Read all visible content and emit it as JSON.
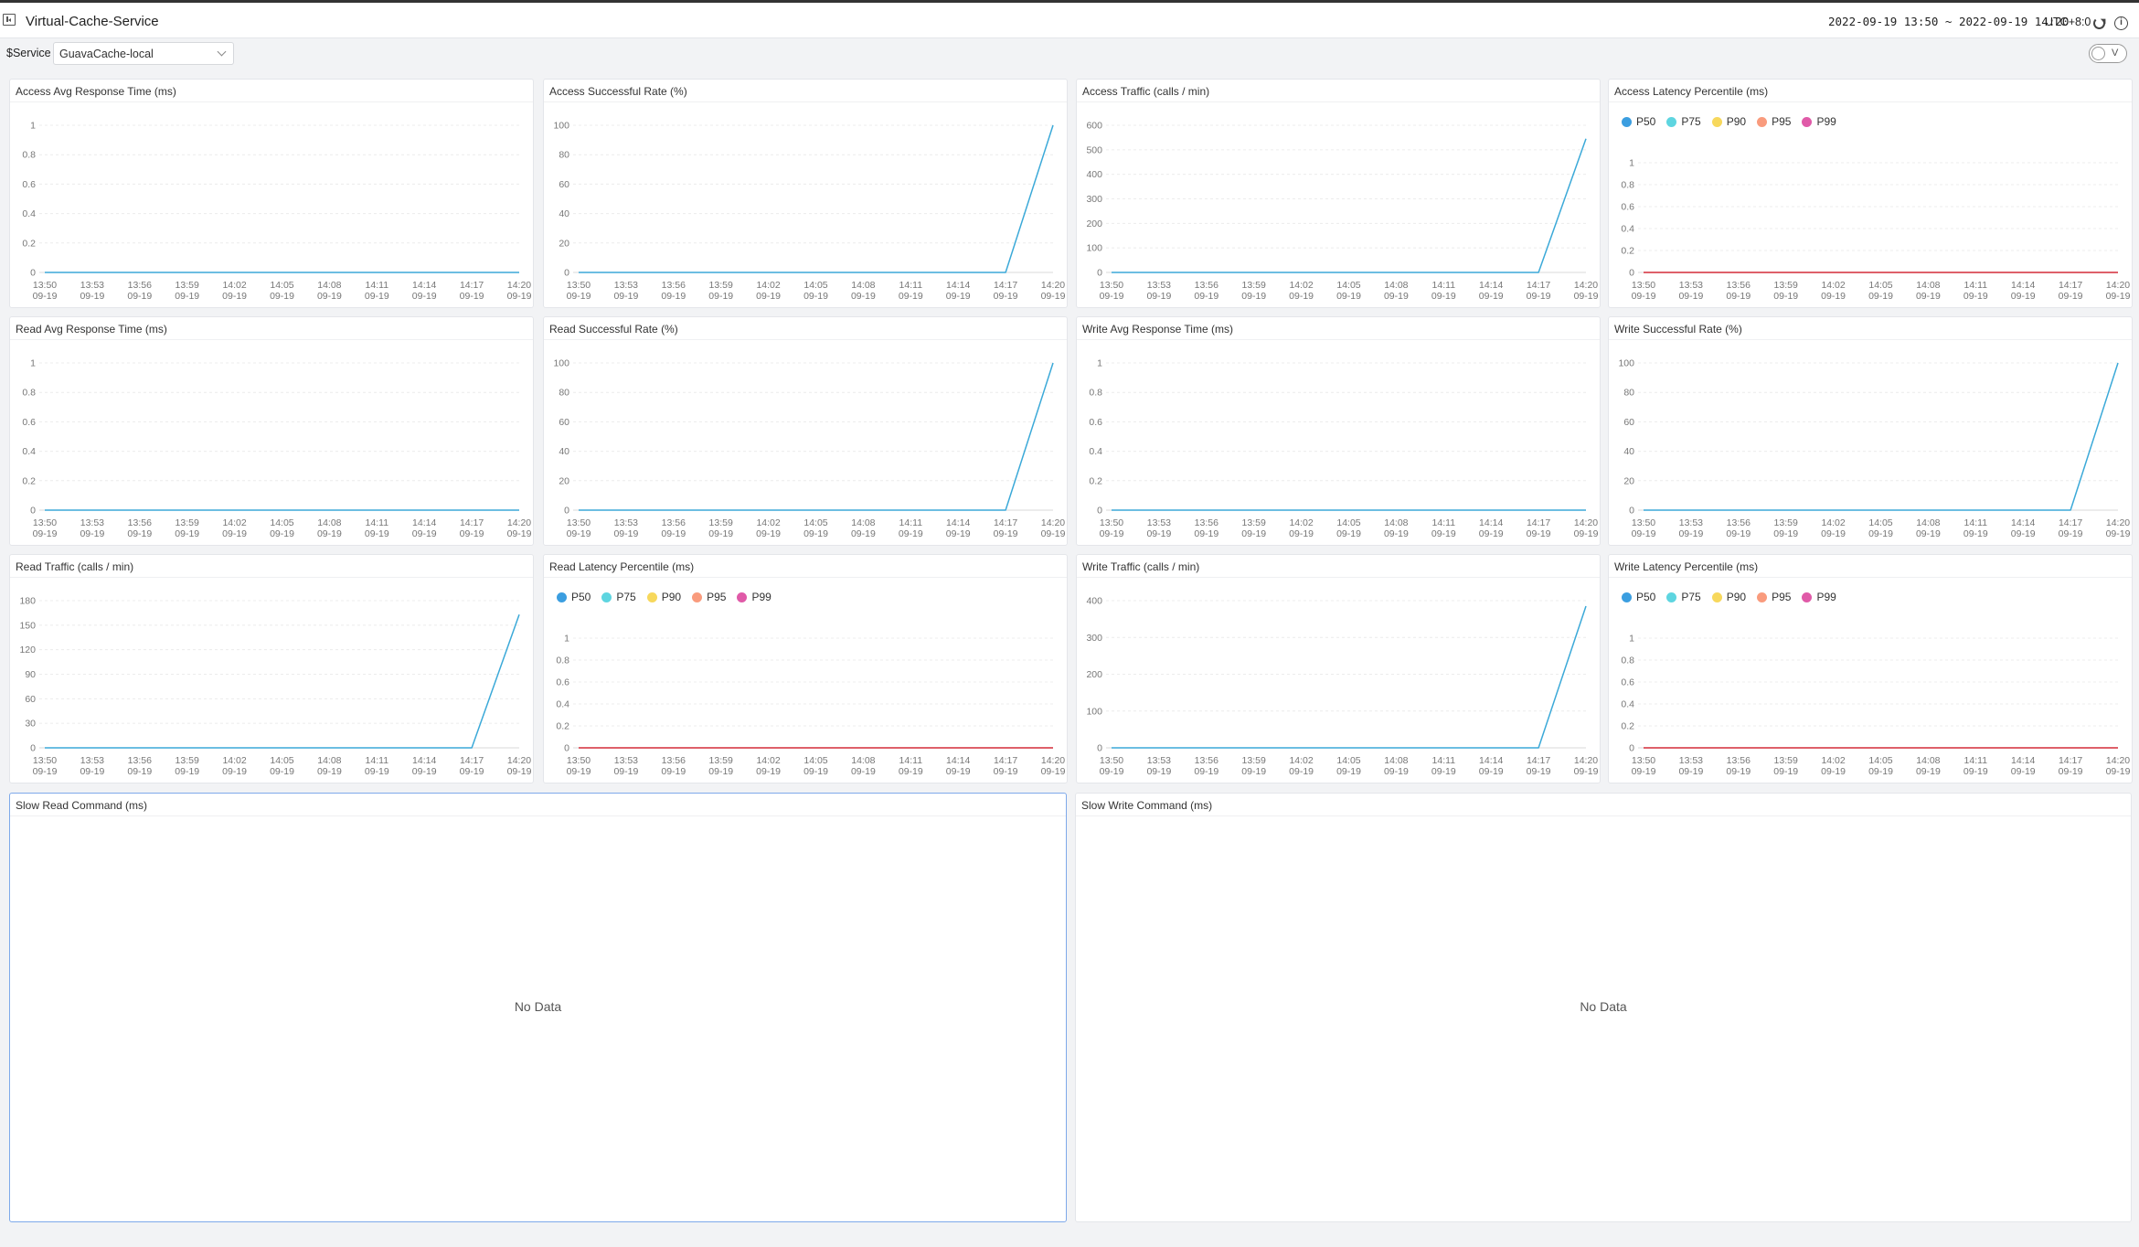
{
  "header": {
    "title": "Virtual-Cache-Service",
    "time_range": "2022-09-19 13:50 ~ 2022-09-19 14:20",
    "timezone": "UTC+8:0"
  },
  "variables": {
    "label": "$Service",
    "value": "GuavaCache-local"
  },
  "toggle": {
    "label": "V"
  },
  "colors": {
    "line": "#3ba9d8",
    "flat_latency": "#e0425f",
    "grid": "#ececec",
    "tick": "#777777",
    "panel_border": "#e4e6ea",
    "active_border": "#7ea9ea"
  },
  "icons": {
    "menu": "sidebar-toggle-icon",
    "reload": "reload-icon",
    "info": "info-icon",
    "select": "chevron-down-icon"
  },
  "panels": [
    {
      "title": "Access Avg Response Time (ms)"
    },
    {
      "title": "Access Successful Rate (%)"
    },
    {
      "title": "Access Traffic (calls / min)"
    },
    {
      "title": "Access Latency Percentile (ms)"
    },
    {
      "title": "Read Avg Response Time (ms)"
    },
    {
      "title": "Read Successful Rate (%)"
    },
    {
      "title": "Write Avg Response Time (ms)"
    },
    {
      "title": "Write Successful Rate (%)"
    },
    {
      "title": "Read Traffic (calls / min)"
    },
    {
      "title": "Read Latency Percentile (ms)"
    },
    {
      "title": "Write Traffic (calls / min)"
    },
    {
      "title": "Write Latency Percentile (ms)"
    },
    {
      "title": "Slow Read Command (ms)",
      "empty_text": "No Data"
    },
    {
      "title": "Slow Write Command (ms)",
      "empty_text": "No Data"
    }
  ],
  "chart_data": [
    {
      "type": "line",
      "title": "Access Avg Response Time (ms)",
      "x": [
        "13:50\n09-19",
        "13:53\n09-19",
        "13:56\n09-19",
        "13:59\n09-19",
        "14:02\n09-19",
        "14:05\n09-19",
        "14:08\n09-19",
        "14:11\n09-19",
        "14:14\n09-19",
        "14:17\n09-19",
        "14:20\n09-19"
      ],
      "ylim": [
        0,
        1
      ],
      "yticks": [
        "0",
        "0.2",
        "0.4",
        "0.6",
        "0.8",
        "1"
      ],
      "series": [
        {
          "values": [
            0,
            0,
            0,
            0,
            0,
            0,
            0,
            0,
            0,
            0,
            0
          ],
          "color": "#3ba9d8"
        }
      ]
    },
    {
      "type": "line",
      "title": "Access Successful Rate (%)",
      "x": [
        "13:50\n09-19",
        "13:53\n09-19",
        "13:56\n09-19",
        "13:59\n09-19",
        "14:02\n09-19",
        "14:05\n09-19",
        "14:08\n09-19",
        "14:11\n09-19",
        "14:14\n09-19",
        "14:17\n09-19",
        "14:20\n09-19"
      ],
      "ylim": [
        0,
        100
      ],
      "yticks": [
        "0",
        "20",
        "40",
        "60",
        "80",
        "100"
      ],
      "series": [
        {
          "values": [
            0,
            0,
            0,
            0,
            0,
            0,
            0,
            0,
            0,
            0,
            100
          ],
          "color": "#3ba9d8"
        }
      ]
    },
    {
      "type": "line",
      "title": "Access Traffic (calls / min)",
      "x": [
        "13:50\n09-19",
        "13:53\n09-19",
        "13:56\n09-19",
        "13:59\n09-19",
        "14:02\n09-19",
        "14:05\n09-19",
        "14:08\n09-19",
        "14:11\n09-19",
        "14:14\n09-19",
        "14:17\n09-19",
        "14:20\n09-19"
      ],
      "ylim": [
        0,
        600
      ],
      "yticks": [
        "0",
        "100",
        "200",
        "300",
        "400",
        "500",
        "600"
      ],
      "series": [
        {
          "values": [
            0,
            0,
            0,
            0,
            0,
            0,
            0,
            0,
            0,
            0,
            545
          ],
          "color": "#3ba9d8"
        }
      ]
    },
    {
      "type": "line",
      "title": "Access Latency Percentile (ms)",
      "x": [
        "13:50\n09-19",
        "13:53\n09-19",
        "13:56\n09-19",
        "13:59\n09-19",
        "14:02\n09-19",
        "14:05\n09-19",
        "14:08\n09-19",
        "14:11\n09-19",
        "14:14\n09-19",
        "14:17\n09-19",
        "14:20\n09-19"
      ],
      "ylim": [
        0,
        1
      ],
      "yticks": [
        "0",
        "0.2",
        "0.4",
        "0.6",
        "0.8",
        "1"
      ],
      "legend": [
        {
          "name": "P50",
          "color": "#3b9ee0"
        },
        {
          "name": "P75",
          "color": "#5ed5e0"
        },
        {
          "name": "P90",
          "color": "#f7d85c"
        },
        {
          "name": "P95",
          "color": "#f99b7d"
        },
        {
          "name": "P99",
          "color": "#e05aa8"
        }
      ],
      "series": [
        {
          "name": "P50",
          "values": [
            0,
            0,
            0,
            0,
            0,
            0,
            0,
            0,
            0,
            0,
            0
          ],
          "color": "#3b9ee0"
        },
        {
          "name": "P75",
          "values": [
            0,
            0,
            0,
            0,
            0,
            0,
            0,
            0,
            0,
            0,
            0
          ],
          "color": "#5ed5e0"
        },
        {
          "name": "P90",
          "values": [
            0,
            0,
            0,
            0,
            0,
            0,
            0,
            0,
            0,
            0,
            0
          ],
          "color": "#f7d85c"
        },
        {
          "name": "P95",
          "values": [
            0,
            0,
            0,
            0,
            0,
            0,
            0,
            0,
            0,
            0,
            0
          ],
          "color": "#f99b7d"
        },
        {
          "name": "P99",
          "values": [
            0,
            0,
            0,
            0,
            0,
            0,
            0,
            0,
            0,
            0,
            0
          ],
          "color": "#e0425f"
        }
      ]
    },
    {
      "type": "line",
      "title": "Read Avg Response Time (ms)",
      "x": [
        "13:50\n09-19",
        "13:53\n09-19",
        "13:56\n09-19",
        "13:59\n09-19",
        "14:02\n09-19",
        "14:05\n09-19",
        "14:08\n09-19",
        "14:11\n09-19",
        "14:14\n09-19",
        "14:17\n09-19",
        "14:20\n09-19"
      ],
      "ylim": [
        0,
        1
      ],
      "yticks": [
        "0",
        "0.2",
        "0.4",
        "0.6",
        "0.8",
        "1"
      ],
      "series": [
        {
          "values": [
            0,
            0,
            0,
            0,
            0,
            0,
            0,
            0,
            0,
            0,
            0
          ],
          "color": "#3ba9d8"
        }
      ]
    },
    {
      "type": "line",
      "title": "Read Successful Rate (%)",
      "x": [
        "13:50\n09-19",
        "13:53\n09-19",
        "13:56\n09-19",
        "13:59\n09-19",
        "14:02\n09-19",
        "14:05\n09-19",
        "14:08\n09-19",
        "14:11\n09-19",
        "14:14\n09-19",
        "14:17\n09-19",
        "14:20\n09-19"
      ],
      "ylim": [
        0,
        100
      ],
      "yticks": [
        "0",
        "20",
        "40",
        "60",
        "80",
        "100"
      ],
      "series": [
        {
          "values": [
            0,
            0,
            0,
            0,
            0,
            0,
            0,
            0,
            0,
            0,
            100
          ],
          "color": "#3ba9d8"
        }
      ]
    },
    {
      "type": "line",
      "title": "Write Avg Response Time (ms)",
      "x": [
        "13:50\n09-19",
        "13:53\n09-19",
        "13:56\n09-19",
        "13:59\n09-19",
        "14:02\n09-19",
        "14:05\n09-19",
        "14:08\n09-19",
        "14:11\n09-19",
        "14:14\n09-19",
        "14:17\n09-19",
        "14:20\n09-19"
      ],
      "ylim": [
        0,
        1
      ],
      "yticks": [
        "0",
        "0.2",
        "0.4",
        "0.6",
        "0.8",
        "1"
      ],
      "series": [
        {
          "values": [
            0,
            0,
            0,
            0,
            0,
            0,
            0,
            0,
            0,
            0,
            0
          ],
          "color": "#3ba9d8"
        }
      ]
    },
    {
      "type": "line",
      "title": "Write Successful Rate (%)",
      "x": [
        "13:50\n09-19",
        "13:53\n09-19",
        "13:56\n09-19",
        "13:59\n09-19",
        "14:02\n09-19",
        "14:05\n09-19",
        "14:08\n09-19",
        "14:11\n09-19",
        "14:14\n09-19",
        "14:17\n09-19",
        "14:20\n09-19"
      ],
      "ylim": [
        0,
        100
      ],
      "yticks": [
        "0",
        "20",
        "40",
        "60",
        "80",
        "100"
      ],
      "series": [
        {
          "values": [
            0,
            0,
            0,
            0,
            0,
            0,
            0,
            0,
            0,
            0,
            100
          ],
          "color": "#3ba9d8"
        }
      ]
    },
    {
      "type": "line",
      "title": "Read Traffic (calls / min)",
      "x": [
        "13:50\n09-19",
        "13:53\n09-19",
        "13:56\n09-19",
        "13:59\n09-19",
        "14:02\n09-19",
        "14:05\n09-19",
        "14:08\n09-19",
        "14:11\n09-19",
        "14:14\n09-19",
        "14:17\n09-19",
        "14:20\n09-19"
      ],
      "ylim": [
        0,
        180
      ],
      "yticks": [
        "0",
        "30",
        "60",
        "90",
        "120",
        "150",
        "180"
      ],
      "series": [
        {
          "values": [
            0,
            0,
            0,
            0,
            0,
            0,
            0,
            0,
            0,
            0,
            163
          ],
          "color": "#3ba9d8"
        }
      ]
    },
    {
      "type": "line",
      "title": "Read Latency Percentile (ms)",
      "x": [
        "13:50\n09-19",
        "13:53\n09-19",
        "13:56\n09-19",
        "13:59\n09-19",
        "14:02\n09-19",
        "14:05\n09-19",
        "14:08\n09-19",
        "14:11\n09-19",
        "14:14\n09-19",
        "14:17\n09-19",
        "14:20\n09-19"
      ],
      "ylim": [
        0,
        1
      ],
      "yticks": [
        "0",
        "0.2",
        "0.4",
        "0.6",
        "0.8",
        "1"
      ],
      "legend": [
        {
          "name": "P50",
          "color": "#3b9ee0"
        },
        {
          "name": "P75",
          "color": "#5ed5e0"
        },
        {
          "name": "P90",
          "color": "#f7d85c"
        },
        {
          "name": "P95",
          "color": "#f99b7d"
        },
        {
          "name": "P99",
          "color": "#e05aa8"
        }
      ],
      "series": [
        {
          "name": "P50",
          "values": [
            0,
            0,
            0,
            0,
            0,
            0,
            0,
            0,
            0,
            0,
            0
          ],
          "color": "#3b9ee0"
        },
        {
          "name": "P75",
          "values": [
            0,
            0,
            0,
            0,
            0,
            0,
            0,
            0,
            0,
            0,
            0
          ],
          "color": "#5ed5e0"
        },
        {
          "name": "P90",
          "values": [
            0,
            0,
            0,
            0,
            0,
            0,
            0,
            0,
            0,
            0,
            0
          ],
          "color": "#f7d85c"
        },
        {
          "name": "P95",
          "values": [
            0,
            0,
            0,
            0,
            0,
            0,
            0,
            0,
            0,
            0,
            0
          ],
          "color": "#f99b7d"
        },
        {
          "name": "P99",
          "values": [
            0,
            0,
            0,
            0,
            0,
            0,
            0,
            0,
            0,
            0,
            0
          ],
          "color": "#e0425f"
        }
      ]
    },
    {
      "type": "line",
      "title": "Write Traffic (calls / min)",
      "x": [
        "13:50\n09-19",
        "13:53\n09-19",
        "13:56\n09-19",
        "13:59\n09-19",
        "14:02\n09-19",
        "14:05\n09-19",
        "14:08\n09-19",
        "14:11\n09-19",
        "14:14\n09-19",
        "14:17\n09-19",
        "14:20\n09-19"
      ],
      "ylim": [
        0,
        400
      ],
      "yticks": [
        "0",
        "100",
        "200",
        "300",
        "400"
      ],
      "series": [
        {
          "values": [
            0,
            0,
            0,
            0,
            0,
            0,
            0,
            0,
            0,
            0,
            385
          ],
          "color": "#3ba9d8"
        }
      ]
    },
    {
      "type": "line",
      "title": "Write Latency Percentile (ms)",
      "x": [
        "13:50\n09-19",
        "13:53\n09-19",
        "13:56\n09-19",
        "13:59\n09-19",
        "14:02\n09-19",
        "14:05\n09-19",
        "14:08\n09-19",
        "14:11\n09-19",
        "14:14\n09-19",
        "14:17\n09-19",
        "14:20\n09-19"
      ],
      "ylim": [
        0,
        1
      ],
      "yticks": [
        "0",
        "0.2",
        "0.4",
        "0.6",
        "0.8",
        "1"
      ],
      "legend": [
        {
          "name": "P50",
          "color": "#3b9ee0"
        },
        {
          "name": "P75",
          "color": "#5ed5e0"
        },
        {
          "name": "P90",
          "color": "#f7d85c"
        },
        {
          "name": "P95",
          "color": "#f99b7d"
        },
        {
          "name": "P99",
          "color": "#e05aa8"
        }
      ],
      "series": [
        {
          "name": "P50",
          "values": [
            0,
            0,
            0,
            0,
            0,
            0,
            0,
            0,
            0,
            0,
            0
          ],
          "color": "#3b9ee0"
        },
        {
          "name": "P75",
          "values": [
            0,
            0,
            0,
            0,
            0,
            0,
            0,
            0,
            0,
            0,
            0
          ],
          "color": "#5ed5e0"
        },
        {
          "name": "P90",
          "values": [
            0,
            0,
            0,
            0,
            0,
            0,
            0,
            0,
            0,
            0,
            0
          ],
          "color": "#f7d85c"
        },
        {
          "name": "P95",
          "values": [
            0,
            0,
            0,
            0,
            0,
            0,
            0,
            0,
            0,
            0,
            0
          ],
          "color": "#f99b7d"
        },
        {
          "name": "P99",
          "values": [
            0,
            0,
            0,
            0,
            0,
            0,
            0,
            0,
            0,
            0,
            0
          ],
          "color": "#e0425f"
        }
      ]
    }
  ]
}
